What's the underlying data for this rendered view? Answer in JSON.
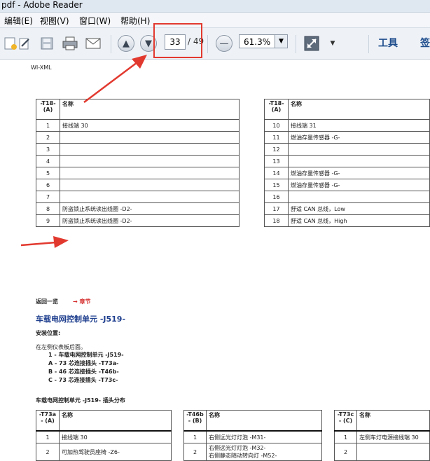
{
  "window": {
    "title": "pdf - Adobe Reader"
  },
  "menu": {
    "edit": "编辑(E)",
    "view": "视图(V)",
    "window": "窗口(W)",
    "help": "帮助(H)"
  },
  "toolbar": {
    "page_current": "33",
    "page_total": "/ 49",
    "zoom": "61.3%",
    "tools_label": "工具",
    "sign_label": "签"
  },
  "document": {
    "header_mark": "WI-XML",
    "connector_table": {
      "col_headers": [
        "-T18-\n(A)",
        "名称",
        "-T18-\n(A)",
        "名称"
      ],
      "rows": [
        {
          "n1": "1",
          "name1": "接线端 30",
          "n2": "10",
          "name2": "接线端 31"
        },
        {
          "n1": "2",
          "name1": "",
          "n2": "11",
          "name2": "燃油存量传感器 -G-"
        },
        {
          "n1": "3",
          "name1": "",
          "n2": "12",
          "name2": ""
        },
        {
          "n1": "4",
          "name1": "",
          "n2": "13",
          "name2": ""
        },
        {
          "n1": "5",
          "name1": "",
          "n2": "14",
          "name2": "燃油存量传感器 -G-"
        },
        {
          "n1": "6",
          "name1": "",
          "n2": "15",
          "name2": "燃油存量传感器 -G-"
        },
        {
          "n1": "7",
          "name1": "",
          "n2": "16",
          "name2": ""
        },
        {
          "n1": "8",
          "name1": "防盗锁止系统读出线圈 -D2-",
          "n2": "17",
          "name2": "舒适 CAN 总线，Low"
        },
        {
          "n1": "9",
          "name1": "防盗锁止系统读出线圈 -D2-",
          "n2": "18",
          "name2": "舒适 CAN 总线，High"
        }
      ]
    },
    "back_link": "返回一览",
    "chapter_link": "→ 章节",
    "section_title": "车载电网控制单元 -J519-",
    "install_label": "安装位置:",
    "install_text": "在左侧仪表板后面。",
    "legend": [
      "1 - 车载电网控制单元 -J519-",
      "A - 73 芯连接插头 -T73a-",
      "B - 46 芯连接插头 -T46b-",
      "C - 73 芯连接插头 -T73c-"
    ],
    "pin_dist_title": "车载电网控制单元 -J519- 插头分布",
    "pin_table": {
      "h1": "-T73a\n- (A)",
      "h2": "名称",
      "h3": "-T46b\n- (B)",
      "h4": "名称",
      "h5": "-T73c\n- (C)",
      "h6": "名称",
      "rows": [
        {
          "a": "1",
          "an": "接线端 30",
          "b": "1",
          "bn": "右侧远光灯灯泡 -M31-",
          "c": "1",
          "cn": "左侧车灯电源接线端 30"
        },
        {
          "a": "2",
          "an": "可加热驾驶员座椅 -Z6-",
          "b": "2",
          "bn": "右侧远光灯灯泡 -M32-",
          "bn2": "右侧静态随动转向灯 -M52-",
          "c": "2",
          "cn": ""
        }
      ]
    }
  },
  "colors": {
    "annotation_red": "#e2392f",
    "heading_blue": "#1f3f8e",
    "chapter_red": "#d42a2a"
  }
}
